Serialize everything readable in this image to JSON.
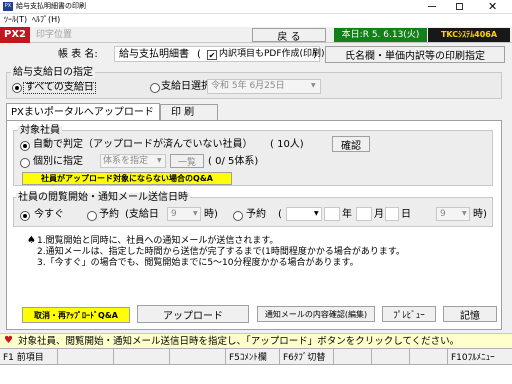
{
  "window": {
    "title": "給与支払明細書の印刷"
  },
  "menu": {
    "items": [
      "ﾂｰﾙ(T)",
      "ﾍﾙﾌﾟ(H)"
    ]
  },
  "toolbar": {
    "px2": "PX2",
    "print_position": "印字位置",
    "back": "戻 る",
    "today": "本日:R 5. 6.13(火)",
    "brand": "TKCｼｽﾃﾑ406A"
  },
  "form": {
    "label": "帳 表 名:",
    "name": "給与支払明細書",
    "pdf_option": "内訳項目もPDF作成(印刷)",
    "pdf_checked": "✔",
    "close_paren": ")",
    "name_print_button": "氏名欄・単価内訳等の印刷指定"
  },
  "payday": {
    "group_label": "給与支給日の指定",
    "all_label": "すべての支給日",
    "select_label": "支給日選択",
    "date_value": "令和 5年 6月25日"
  },
  "tabs": [
    {
      "label": "PXまいポータルへアップロード"
    },
    {
      "label": "印 刷"
    }
  ],
  "employees": {
    "group_label": "対象社員",
    "auto_label": "自動で判定（アップロードが済んでいない社員）",
    "auto_count": "(      10人)",
    "confirm_button": "確認",
    "individual_label": "個別に指定",
    "system_placeholder": "体系を指定",
    "list_button": "一覧",
    "individual_count": "(  0/  5体系)",
    "qa_button": "社員がアップロード対象にならない場合のQ&A"
  },
  "schedule": {
    "group_label": "社員の閲覧開始・通知メール送信日時",
    "now_label": "今すぐ",
    "reserve1_label": "予約",
    "payday_paren": "(支給日",
    "hour1_value": "9",
    "hour_unit": "時)",
    "reserve2_label": "予約",
    "open_paren": "(",
    "year_unit": "年",
    "month_unit": "月",
    "day_unit": "日",
    "hour2_value": "9",
    "hour2_unit": "時)"
  },
  "notes": {
    "mark": "♠",
    "lines": [
      "1.閲覧開始と同時に、社員への通知メールが送信されます。",
      "2.通知メールは、指定した時間から送信が完了するまで(1時間程度かかる場合があります。",
      "3.「今すぐ」の場合でも、閲覧開始までに5～10分程度かかる場合があります。"
    ]
  },
  "buttons": {
    "cancel_qa": "取消・再ｱｯﾌﾟﾛｰﾄﾞQ&A",
    "upload": "アップロード",
    "notify_confirm": "通知メールの内容確認(編集)",
    "preview": "ﾌﾟﾚﾋﾞｭｰ",
    "memo": "記憶"
  },
  "message": {
    "text": "対象社員、閲覧開始・通知メール送信日時を指定し、「アップロード」ボタンをクリックしてください。"
  },
  "fkeys": [
    {
      "label": "F1 前項目"
    },
    {
      "label": ""
    },
    {
      "label": ""
    },
    {
      "label": ""
    },
    {
      "label": "F5ｺﾒﾝﾄ欄"
    },
    {
      "label": "F6ﾀﾌﾞ切替"
    },
    {
      "label": ""
    },
    {
      "label": ""
    },
    {
      "label": ""
    },
    {
      "label": "F10ﾌﾙﾒﾆｭｰ"
    }
  ],
  "colors": {
    "px2_bg": "#c0181c",
    "today_bg": "#14801a",
    "brand_bg": "#181818",
    "brand_fg": "#ffd400",
    "yellow_button": "#ffff00",
    "message_bg": "#ffffcc"
  }
}
